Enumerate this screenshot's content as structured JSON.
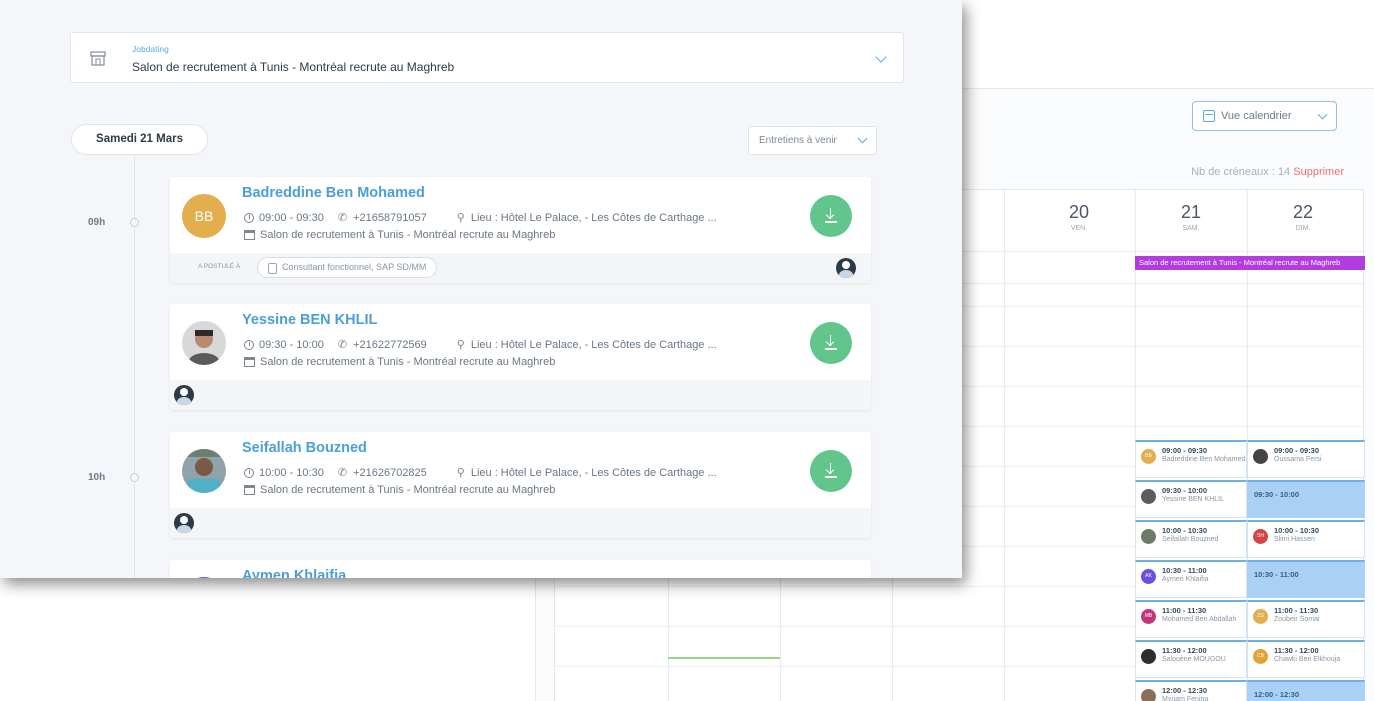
{
  "calendar": {
    "view_label": "Vue calendrier",
    "slots_label": "Nb de créneaux : 14",
    "delete_label": "Supprimer",
    "days": [
      {
        "num": "20",
        "name": "VEN."
      },
      {
        "num": "21",
        "name": "SAM."
      },
      {
        "num": "22",
        "name": "DIM."
      }
    ],
    "event_banner": "Salon de recrutement à Tunis - Montréal recrute au Maghreb",
    "sat_slots": [
      {
        "time": "09:00 - 09:30",
        "name": "Badreddine Ben Mohamed",
        "initials": "BB",
        "color": "#e2ae4e"
      },
      {
        "time": "09:30 - 10:00",
        "name": "Yessine BEN KHLIL",
        "initials": "",
        "color": "#5c5c5c"
      },
      {
        "time": "10:00 - 10:30",
        "name": "Seifallah Bouzned",
        "initials": "",
        "color": "#6d7c6a"
      },
      {
        "time": "10:30 - 11:00",
        "name": "Aymen Khlaifia",
        "initials": "AK",
        "color": "#6a4fe0"
      },
      {
        "time": "11:00 - 11:30",
        "name": "Mohamed Ben Abdallah",
        "initials": "MB",
        "color": "#c2377a"
      },
      {
        "time": "11:30 - 12:00",
        "name": "Salouène MOUGOU",
        "initials": "",
        "color": "#2d2d2d"
      },
      {
        "time": "12:00 - 12:30",
        "name": "Myriam Fenina",
        "initials": "",
        "color": "#8a6d5a"
      }
    ],
    "sun_slots": [
      {
        "time": "09:00 - 09:30",
        "name": "Oussama Fersi",
        "initials": "",
        "color": "#444444",
        "free": false
      },
      {
        "time": "09:30 - 10:00",
        "name": "",
        "initials": "",
        "color": "",
        "free": true
      },
      {
        "time": "10:00 - 10:30",
        "name": "Slimi Hassen",
        "initials": "SH",
        "color": "#d64545",
        "free": false
      },
      {
        "time": "10:30 - 11:00",
        "name": "",
        "initials": "",
        "color": "",
        "free": true
      },
      {
        "time": "11:00 - 11:30",
        "name": "Zoubeir Somai",
        "initials": "ZS",
        "color": "#e2ae4e",
        "free": false
      },
      {
        "time": "11:30 - 12:00",
        "name": "Chawki Ben Elkhouja",
        "initials": "CB",
        "color": "#e2a23a",
        "free": false
      },
      {
        "time": "12:00 - 12:30",
        "name": "",
        "initials": "",
        "color": "",
        "free": true
      }
    ]
  },
  "list": {
    "select_label": "Jobdating",
    "select_value": "Salon de recrutement à Tunis - Montréal recrute au Maghreb",
    "date": "Samedi 21 Mars",
    "filter": "Entretiens à venir",
    "hours": [
      "09h",
      "10h"
    ],
    "applied_label": "A POSTULÉ À",
    "cards": [
      {
        "name": "Badreddine Ben Mohamed",
        "initials": "BB",
        "time": "09:00 - 09:30",
        "phone": "+21658791057",
        "place": "Lieu : Hôtel Le Palace, - Les Côtes de Carthage ...",
        "event": "Salon de recrutement à Tunis - Montréal recrute au Maghreb",
        "job": "Consultant fonctionnel, SAP SD/MM"
      },
      {
        "name": "Yessine BEN KHLIL",
        "initials": "",
        "time": "09:30 - 10:00",
        "phone": "+21622772569",
        "place": "Lieu : Hôtel Le Palace, - Les Côtes de Carthage ...",
        "event": "Salon de recrutement à Tunis - Montréal recrute au Maghreb",
        "job": ""
      },
      {
        "name": "Seifallah Bouzned",
        "initials": "",
        "time": "10:00 - 10:30",
        "phone": "+21626702825",
        "place": "Lieu : Hôtel Le Palace, - Les Côtes de Carthage ...",
        "event": "Salon de recrutement à Tunis - Montréal recrute au Maghreb",
        "job": ""
      },
      {
        "name": "Aymen Khlaifia",
        "initials": "",
        "time": "",
        "phone": "",
        "place": "",
        "event": "",
        "job": ""
      }
    ]
  }
}
